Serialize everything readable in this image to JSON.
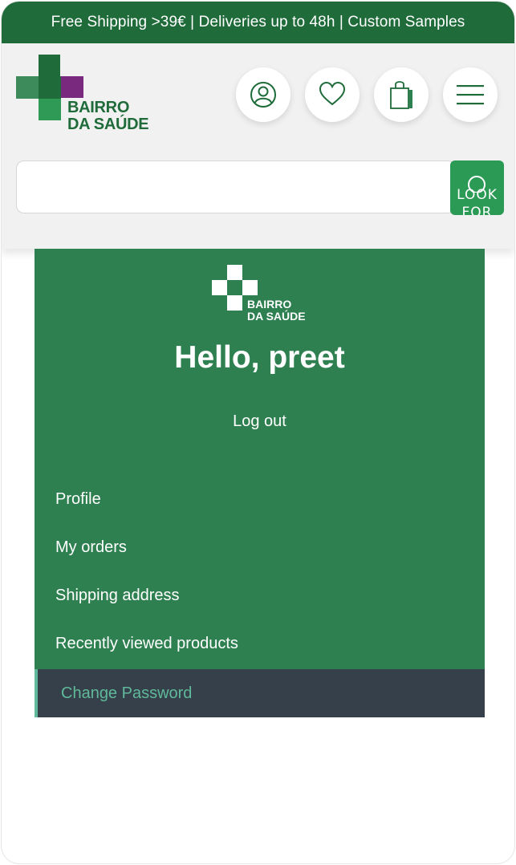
{
  "topbar": {
    "text": "Free Shipping >39€ | Deliveries up to 48h | Custom Samples"
  },
  "brand": {
    "line1": "BAIRRO",
    "line2": "DA SAÚDE"
  },
  "header_icons": [
    "user-icon",
    "heart-icon",
    "shopping-bag-icon",
    "hamburger-menu-icon"
  ],
  "search": {
    "placeholder": "",
    "button_label": "LOOK FOR"
  },
  "account": {
    "greeting": "Hello, preet",
    "logout": "Log out",
    "menu": [
      {
        "label": "Profile",
        "active": false
      },
      {
        "label": "My orders",
        "active": false
      },
      {
        "label": "Shipping address",
        "active": false
      },
      {
        "label": "Recently viewed products",
        "active": false
      },
      {
        "label": "Change Password",
        "active": true
      }
    ]
  },
  "colors": {
    "topbar": "#1f6b3a",
    "panel": "#2e8050",
    "accent": "#2a9a55",
    "active_bg": "#36404a",
    "active_text": "#5fb99a",
    "logo_purple": "#7a2a7e"
  }
}
